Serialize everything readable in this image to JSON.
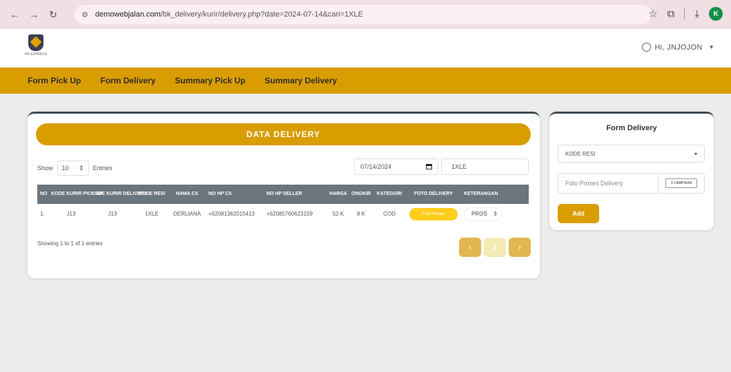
{
  "browser": {
    "url_host": "demowebjalan.com",
    "url_path": "/bk_delivery/kurir/delivery.php?date=2024-07-14&cari=1XLE",
    "profile_initial": "K"
  },
  "header": {
    "logo_text": "BK EXPRESS",
    "user_label": "Hi, JNJOJON"
  },
  "nav": {
    "items": [
      "Form Pick Up",
      "Form Delivery",
      "Summary Pick Up",
      "Summary Delivery"
    ]
  },
  "main": {
    "title": "DATA DELIVERY",
    "show_label": "Show",
    "entries_value": "10",
    "entries_label": "Entries",
    "date_value": "07/14/2024",
    "search_value": "1XLE",
    "columns": [
      "NO",
      "KODE KURIR PICK UP",
      "KODE KURIR DELIVERY",
      "KODE RESI",
      "NAMA CS",
      "NO HP CS",
      "NO HP SELLER",
      "HARGA",
      "ONGKIR",
      "KATEGORI",
      "FOTO DELIVERY",
      "KETERANGAN"
    ],
    "rows": [
      {
        "no": "1.",
        "kurir_pickup": "J13",
        "kurir_delivery": "J13",
        "kode_resi": "1XLE",
        "nama_cs": "DERLIANA",
        "no_hp_cs": "+62081362015413",
        "no_hp_seller": "+62085760623159",
        "harga": "52 K",
        "ongkir": "8 K",
        "kategori": "COD",
        "foto_label": "Foto Proses",
        "keterangan": "PROS"
      }
    ],
    "showing_text": "Showing 1 to 1 of 1 entries",
    "pagination": {
      "current": "1"
    }
  },
  "side_form": {
    "title": "Form Delivery",
    "kode_placeholder": "KODE RESI",
    "file_placeholder": "Foto Proses Delivery",
    "attach_label": "LAMPIRAN",
    "add_label": "Add"
  },
  "colors": {
    "accent": "#d99d00",
    "table_head": "#6b757d",
    "foto_button": "#ffcd1c"
  }
}
